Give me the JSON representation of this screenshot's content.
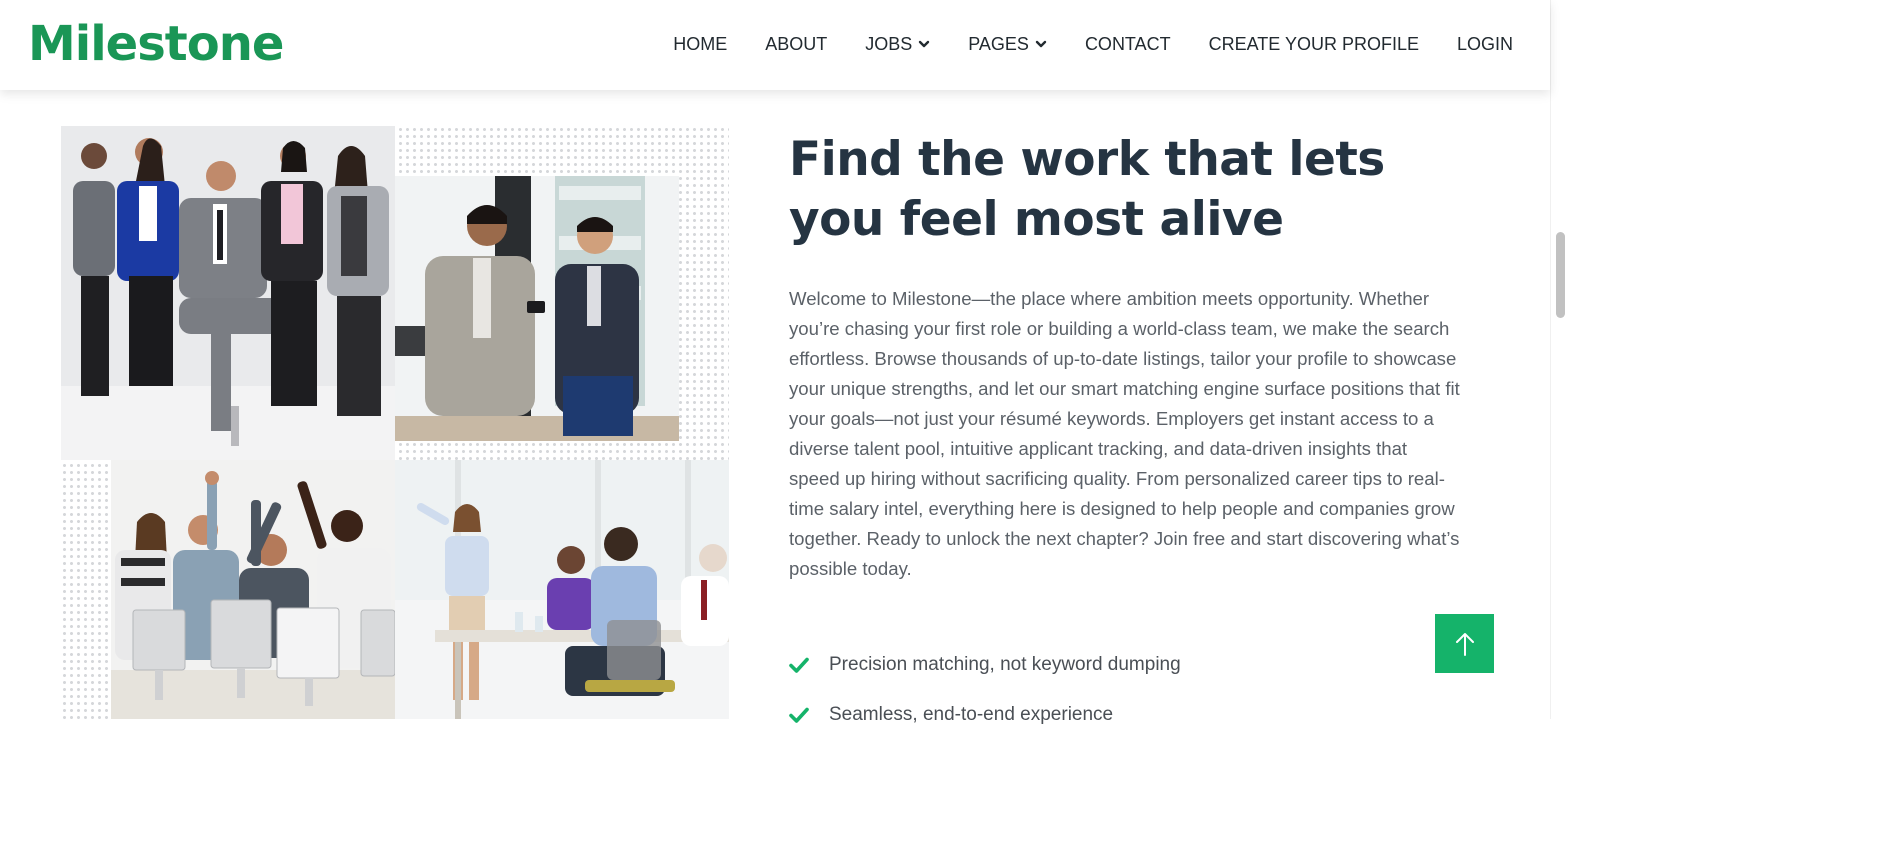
{
  "brand": {
    "name": "Milestone",
    "color": "#1a9656"
  },
  "nav": {
    "items": [
      {
        "label": "HOME",
        "dropdown": false
      },
      {
        "label": "ABOUT",
        "dropdown": false
      },
      {
        "label": "JOBS",
        "dropdown": true
      },
      {
        "label": "PAGES",
        "dropdown": true
      },
      {
        "label": "CONTACT",
        "dropdown": false
      },
      {
        "label": "CREATE YOUR PROFILE",
        "dropdown": false
      },
      {
        "label": "LOGIN",
        "dropdown": false
      }
    ]
  },
  "gallery": {
    "images": [
      {
        "icon": "team-group-photo"
      },
      {
        "icon": "two-colleagues-phone-photo"
      },
      {
        "icon": "office-celebration-photo"
      },
      {
        "icon": "meeting-presentation-photo"
      }
    ]
  },
  "hero": {
    "headline": "Find the work that lets you feel most alive",
    "body": "Welcome to Milestone—the place where ambition meets opportunity. Whether you’re chasing your first role or building a world-class team, we make the search effortless. Browse thousands of up-to-date listings, tailor your profile to showcase your unique strengths, and let our smart matching engine surface positions that fit your goals—not just your résumé keywords. Employers get instant access to a diverse talent pool, intuitive applicant tracking, and data-driven insights that speed up hiring without sacrificing quality. From personalized career tips to real-time salary intel, everything here is designed to help people and companies grow together. Ready to unlock the next chapter? Join free and start discovering what’s possible today."
  },
  "features": [
    {
      "label": "Precision matching, not keyword dumping",
      "icon": "check-icon"
    },
    {
      "label": "Seamless, end-to-end experience",
      "icon": "check-icon"
    }
  ],
  "back_to_top": {
    "icon": "arrow-up-icon",
    "color": "#15b36a"
  },
  "colors": {
    "accent": "#15b36a",
    "heading": "#253442",
    "text": "#5b6168"
  }
}
